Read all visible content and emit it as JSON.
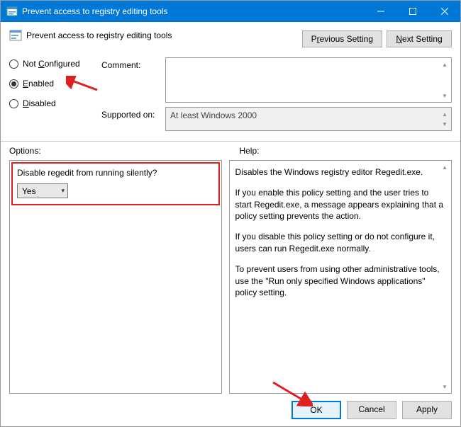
{
  "window": {
    "title": "Prevent access to registry editing tools"
  },
  "header": {
    "title": "Prevent access to registry editing tools",
    "prev_btn_pre": "P",
    "prev_btn_underline": "r",
    "prev_btn_post": "evious Setting",
    "next_btn_underline": "N",
    "next_btn_post": "ext Setting"
  },
  "states": {
    "not_configured_pre": "Not ",
    "not_configured_underline": "C",
    "not_configured_post": "onfigured",
    "enabled_underline": "E",
    "enabled_post": "nabled",
    "disabled_underline": "D",
    "disabled_post": "isabled",
    "selected": "enabled"
  },
  "fields": {
    "comment_label": "Comment:",
    "comment_value": "",
    "supported_label": "Supported on:",
    "supported_value": "At least Windows 2000"
  },
  "sections": {
    "options_label": "Options:",
    "help_label": "Help:"
  },
  "options": {
    "question": "Disable regedit from running silently?",
    "selected": "Yes"
  },
  "help": {
    "p1": "Disables the Windows registry editor Regedit.exe.",
    "p2": "If you enable this policy setting and the user tries to start Regedit.exe, a message appears explaining that a policy setting prevents the action.",
    "p3": "If you disable this policy setting or do not configure it, users can run Regedit.exe normally.",
    "p4": "To prevent users from using other administrative tools, use the \"Run only specified Windows applications\" policy setting."
  },
  "footer": {
    "ok": "OK",
    "cancel": "Cancel",
    "apply": "Apply"
  }
}
